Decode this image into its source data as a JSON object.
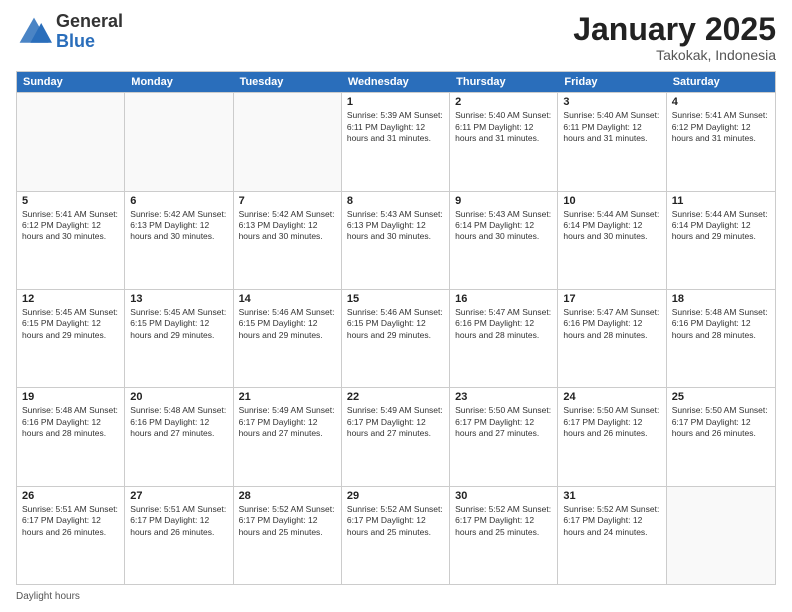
{
  "header": {
    "logo_general": "General",
    "logo_blue": "Blue",
    "title": "January 2025",
    "location": "Takokak, Indonesia"
  },
  "days_of_week": [
    "Sunday",
    "Monday",
    "Tuesday",
    "Wednesday",
    "Thursday",
    "Friday",
    "Saturday"
  ],
  "weeks": [
    [
      {
        "day": "",
        "info": ""
      },
      {
        "day": "",
        "info": ""
      },
      {
        "day": "",
        "info": ""
      },
      {
        "day": "1",
        "info": "Sunrise: 5:39 AM\nSunset: 6:11 PM\nDaylight: 12 hours\nand 31 minutes."
      },
      {
        "day": "2",
        "info": "Sunrise: 5:40 AM\nSunset: 6:11 PM\nDaylight: 12 hours\nand 31 minutes."
      },
      {
        "day": "3",
        "info": "Sunrise: 5:40 AM\nSunset: 6:11 PM\nDaylight: 12 hours\nand 31 minutes."
      },
      {
        "day": "4",
        "info": "Sunrise: 5:41 AM\nSunset: 6:12 PM\nDaylight: 12 hours\nand 31 minutes."
      }
    ],
    [
      {
        "day": "5",
        "info": "Sunrise: 5:41 AM\nSunset: 6:12 PM\nDaylight: 12 hours\nand 30 minutes."
      },
      {
        "day": "6",
        "info": "Sunrise: 5:42 AM\nSunset: 6:13 PM\nDaylight: 12 hours\nand 30 minutes."
      },
      {
        "day": "7",
        "info": "Sunrise: 5:42 AM\nSunset: 6:13 PM\nDaylight: 12 hours\nand 30 minutes."
      },
      {
        "day": "8",
        "info": "Sunrise: 5:43 AM\nSunset: 6:13 PM\nDaylight: 12 hours\nand 30 minutes."
      },
      {
        "day": "9",
        "info": "Sunrise: 5:43 AM\nSunset: 6:14 PM\nDaylight: 12 hours\nand 30 minutes."
      },
      {
        "day": "10",
        "info": "Sunrise: 5:44 AM\nSunset: 6:14 PM\nDaylight: 12 hours\nand 30 minutes."
      },
      {
        "day": "11",
        "info": "Sunrise: 5:44 AM\nSunset: 6:14 PM\nDaylight: 12 hours\nand 29 minutes."
      }
    ],
    [
      {
        "day": "12",
        "info": "Sunrise: 5:45 AM\nSunset: 6:15 PM\nDaylight: 12 hours\nand 29 minutes."
      },
      {
        "day": "13",
        "info": "Sunrise: 5:45 AM\nSunset: 6:15 PM\nDaylight: 12 hours\nand 29 minutes."
      },
      {
        "day": "14",
        "info": "Sunrise: 5:46 AM\nSunset: 6:15 PM\nDaylight: 12 hours\nand 29 minutes."
      },
      {
        "day": "15",
        "info": "Sunrise: 5:46 AM\nSunset: 6:15 PM\nDaylight: 12 hours\nand 29 minutes."
      },
      {
        "day": "16",
        "info": "Sunrise: 5:47 AM\nSunset: 6:16 PM\nDaylight: 12 hours\nand 28 minutes."
      },
      {
        "day": "17",
        "info": "Sunrise: 5:47 AM\nSunset: 6:16 PM\nDaylight: 12 hours\nand 28 minutes."
      },
      {
        "day": "18",
        "info": "Sunrise: 5:48 AM\nSunset: 6:16 PM\nDaylight: 12 hours\nand 28 minutes."
      }
    ],
    [
      {
        "day": "19",
        "info": "Sunrise: 5:48 AM\nSunset: 6:16 PM\nDaylight: 12 hours\nand 28 minutes."
      },
      {
        "day": "20",
        "info": "Sunrise: 5:48 AM\nSunset: 6:16 PM\nDaylight: 12 hours\nand 27 minutes."
      },
      {
        "day": "21",
        "info": "Sunrise: 5:49 AM\nSunset: 6:17 PM\nDaylight: 12 hours\nand 27 minutes."
      },
      {
        "day": "22",
        "info": "Sunrise: 5:49 AM\nSunset: 6:17 PM\nDaylight: 12 hours\nand 27 minutes."
      },
      {
        "day": "23",
        "info": "Sunrise: 5:50 AM\nSunset: 6:17 PM\nDaylight: 12 hours\nand 27 minutes."
      },
      {
        "day": "24",
        "info": "Sunrise: 5:50 AM\nSunset: 6:17 PM\nDaylight: 12 hours\nand 26 minutes."
      },
      {
        "day": "25",
        "info": "Sunrise: 5:50 AM\nSunset: 6:17 PM\nDaylight: 12 hours\nand 26 minutes."
      }
    ],
    [
      {
        "day": "26",
        "info": "Sunrise: 5:51 AM\nSunset: 6:17 PM\nDaylight: 12 hours\nand 26 minutes."
      },
      {
        "day": "27",
        "info": "Sunrise: 5:51 AM\nSunset: 6:17 PM\nDaylight: 12 hours\nand 26 minutes."
      },
      {
        "day": "28",
        "info": "Sunrise: 5:52 AM\nSunset: 6:17 PM\nDaylight: 12 hours\nand 25 minutes."
      },
      {
        "day": "29",
        "info": "Sunrise: 5:52 AM\nSunset: 6:17 PM\nDaylight: 12 hours\nand 25 minutes."
      },
      {
        "day": "30",
        "info": "Sunrise: 5:52 AM\nSunset: 6:17 PM\nDaylight: 12 hours\nand 25 minutes."
      },
      {
        "day": "31",
        "info": "Sunrise: 5:52 AM\nSunset: 6:17 PM\nDaylight: 12 hours\nand 24 minutes."
      },
      {
        "day": "",
        "info": ""
      }
    ]
  ],
  "footer": "Daylight hours"
}
